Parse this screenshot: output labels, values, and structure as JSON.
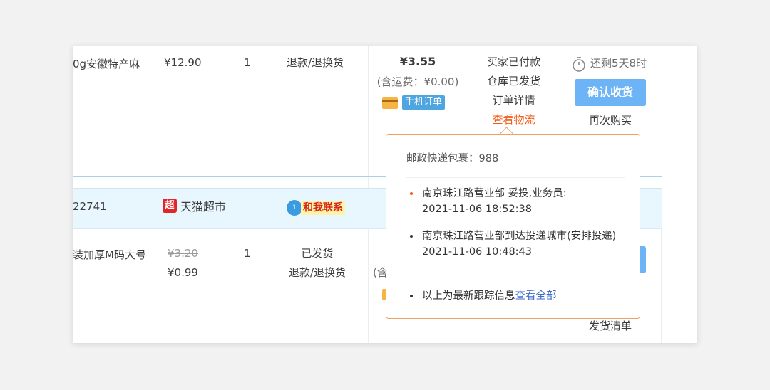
{
  "order1": {
    "product_name_fragment": "0g安徽特产麻",
    "unit_price": "¥12.90",
    "quantity": "1",
    "refund_action": "退款/退换货",
    "total": "¥3.55",
    "shipping_fee": "(含运费：¥0.00)",
    "mobile_tag": "手机订单",
    "status_lines": [
      "买家已付款",
      "仓库已发货",
      "订单详情",
      "查看物流"
    ],
    "countdown": "还剩5天8时",
    "confirm_button": "确认收货",
    "rebuy": "再次购买"
  },
  "shop": {
    "order_no_fragment": "22741",
    "tmall_badge": "超",
    "shop_name": "天猫超市",
    "contact_badge": "1",
    "contact_label": "和我联系"
  },
  "order2": {
    "product_name_fragment": "装加厚M码大号",
    "original_price": "¥3.20",
    "price": "¥0.99",
    "quantity": "1",
    "status": "已发货",
    "refund_action": "退款/退换货",
    "shipping_fee_fragment": "(含",
    "shipping_list": "发货清单"
  },
  "logistics_popup": {
    "title": "邮政快递包裹：988",
    "events": [
      {
        "text": "南京珠江路营业部 妥投,业务员:",
        "time": "2021-11-06 18:52:38",
        "latest": true
      },
      {
        "text": "南京珠江路营业部到达投递城市(安排投递)",
        "time": "2021-11-06 10:48:43",
        "latest": false
      }
    ],
    "footer_text": "以上为最新跟踪信息",
    "footer_link": "查看全部"
  },
  "colors": {
    "accent_orange": "#f25a16",
    "button_blue": "#6cb4f5",
    "link_blue": "#3b6bc9",
    "shop_band": "#e8f6fd"
  }
}
